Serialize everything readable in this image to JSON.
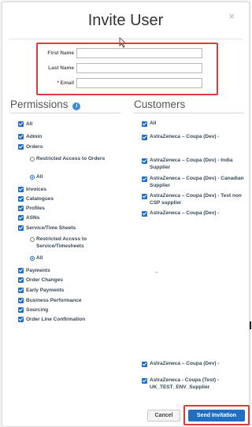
{
  "dialog": {
    "title": "Invite User",
    "close": "×"
  },
  "form": {
    "first_name_label": "First Name",
    "last_name_label": "Last Name",
    "email_label": "Email",
    "email_required_mark": "*",
    "first_name_value": "",
    "last_name_value": "",
    "email_value": ""
  },
  "permissions": {
    "heading": "Permissions",
    "info_icon": "i",
    "items": {
      "all": "All",
      "admin": "Admin",
      "orders": "Orders",
      "orders_restricted": "Restricted Access to Orders",
      "orders_all": "All",
      "invoices": "Invoices",
      "catalogues": "Catalogues",
      "profiles": "Profiles",
      "asns": "ASNs",
      "service_time_sheets": "Service/Time Sheets",
      "sts_restricted": "Restricted Access to Service/Timesheets",
      "sts_all": "All",
      "payments": "Payments",
      "order_changes": "Order Changes",
      "early_payments": "Early Payments",
      "business_performance": "Business Performance",
      "sourcing": "Sourcing",
      "order_line_confirmation": "Order Line Confirmation"
    }
  },
  "customers": {
    "heading": "Customers",
    "items": [
      "All",
      "AstraZeneca – Coupa (Dev) -",
      "AstraZeneca – Coupa (Dev) - India Supplier",
      "AstraZeneca – Coupa (Dev) - Canadian Supplier",
      "AstraZeneca – Coupa (Dev) - Test non CSP supplier",
      "AstraZeneca – Coupa (Dev) -",
      "AstraZeneca – Coupa (Dev) -",
      "AstraZeneca - Coupa (Test) - UK_TEST_ENV_Supplier"
    ]
  },
  "buttons": {
    "cancel": "Cancel",
    "send": "Send Invitation"
  },
  "colors": {
    "accent": "#1f6fc5",
    "highlight": "#e0393b"
  }
}
